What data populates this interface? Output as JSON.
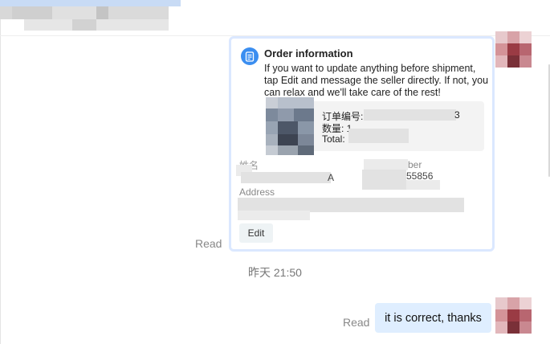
{
  "order_card": {
    "title": "Order information",
    "description": "If you want to update anything before shipment, tap Edit and message the seller directly. If not, you can relax and we'll take care of the rest!",
    "product": {
      "order_no_label": "订单编号:",
      "order_no_tail": "3",
      "quantity_label": "数量: 1",
      "total_label": "Total:"
    },
    "name_label": "姓名",
    "name_value_tail": "A",
    "phone_label_tail": "ber",
    "phone_value_tail": "55856",
    "address_label": "Address",
    "edit_label": "Edit",
    "icon": "document-icon",
    "accent_color": "#3b8ef0",
    "border_color": "#dbe8ff"
  },
  "read_status_1": "Read",
  "timestamp": "昨天 21:50",
  "message": {
    "read_status": "Read",
    "text": "it is correct, thanks",
    "bubble_color": "#dfeeff"
  }
}
